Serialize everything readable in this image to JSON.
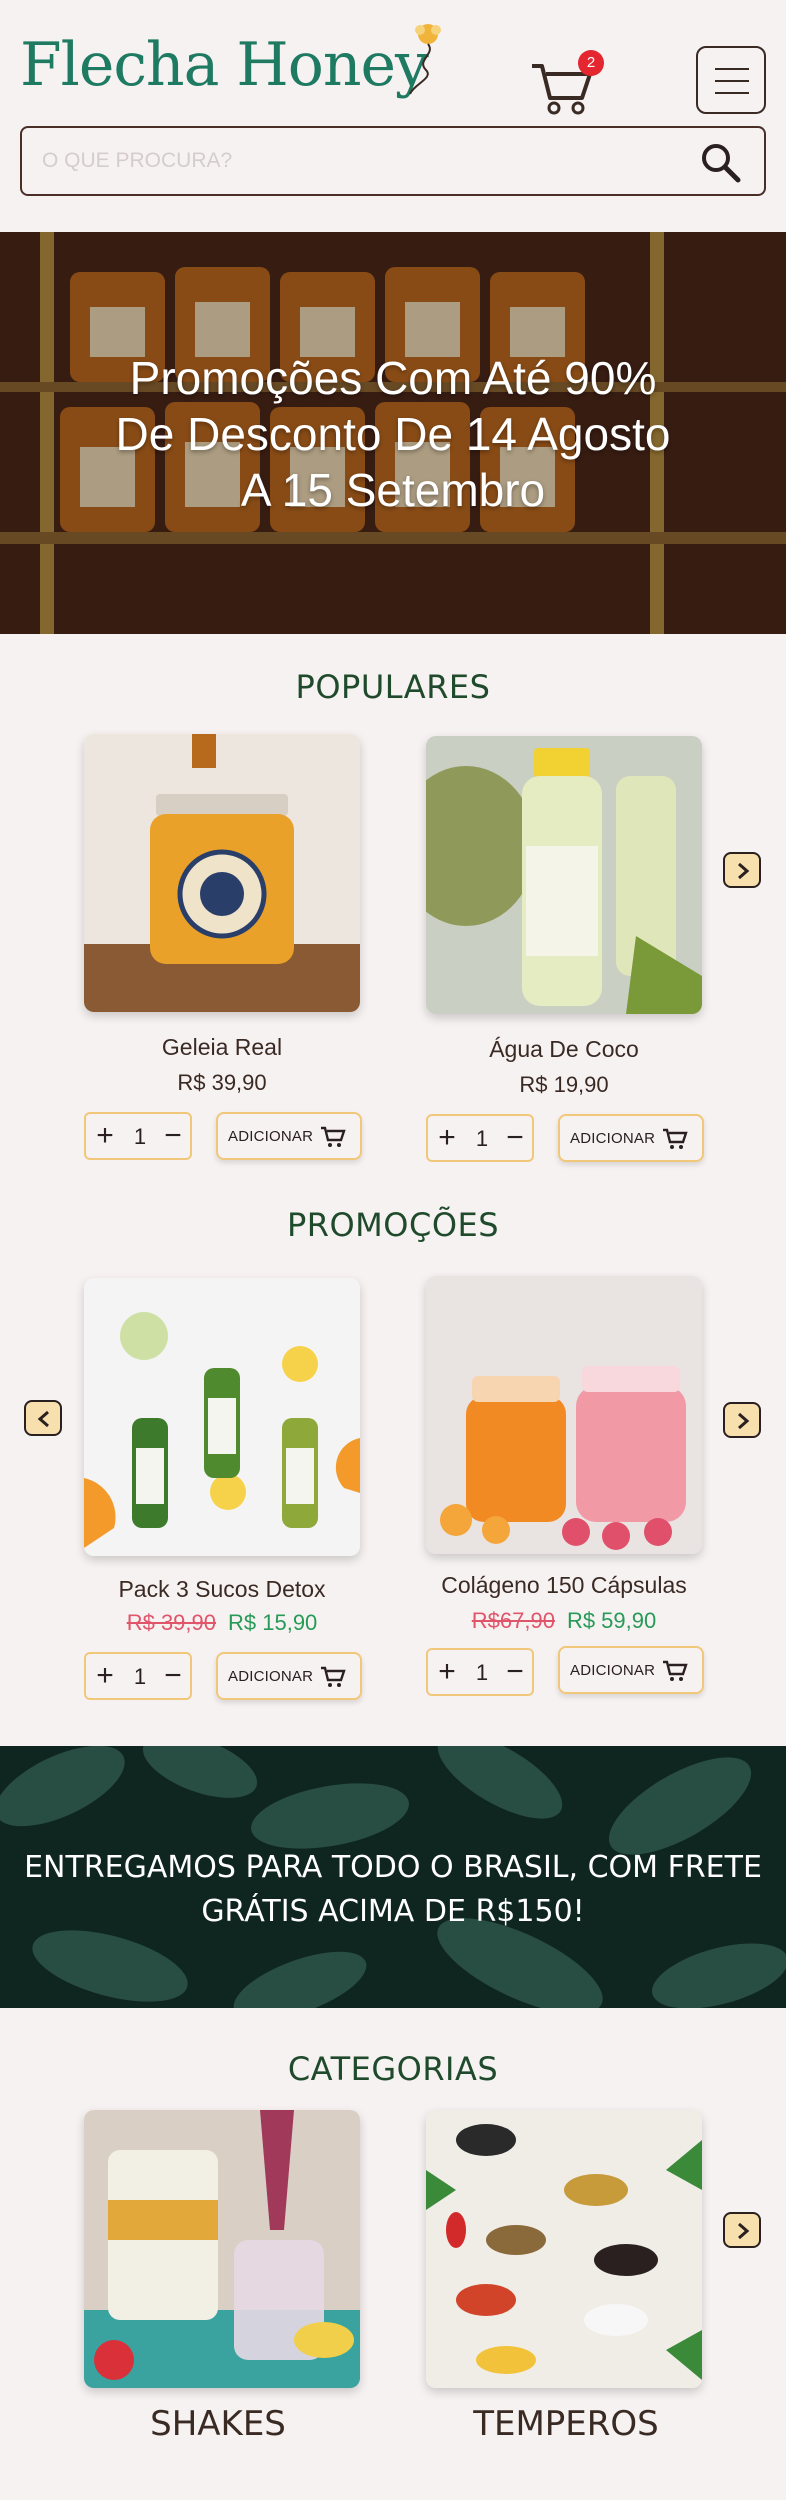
{
  "header": {
    "logo_text": "Flecha Honey",
    "cart_count": "2",
    "search_placeholder": "O QUE PROCURA?"
  },
  "hero": {
    "line1": "Promoções Com Até 90%",
    "line2": "De Desconto De 14 Agosto",
    "line3": "A 15 Setembro"
  },
  "populares": {
    "title": "POPULARES",
    "items": [
      {
        "name": "Geleia Real",
        "price": "R$ 39,90",
        "qty": "1",
        "add_label": "ADICIONAR"
      },
      {
        "name": "Água De Coco",
        "price": "R$ 19,90",
        "qty": "1",
        "add_label": "ADICIONAR"
      }
    ]
  },
  "promocoes": {
    "title": "PROMOÇÕES",
    "items": [
      {
        "name": "Pack 3 Sucos Detox",
        "old_price": "R$ 39,90",
        "new_price": "R$ 15,90",
        "qty": "1",
        "add_label": "ADICIONAR"
      },
      {
        "name": "Colágeno 150 Cápsulas",
        "old_price": "R$67,90",
        "new_price": "R$ 59,90",
        "qty": "1",
        "add_label": "ADICIONAR"
      }
    ]
  },
  "banner": {
    "line1": "ENTREGAMOS PARA TODO O BRASIL, COM FRETE",
    "line2": "GRÁTIS ACIMA DE R$150!"
  },
  "categorias": {
    "title": "CATEGORIAS",
    "items": [
      {
        "label": "SHAKES"
      },
      {
        "label": "TEMPEROS"
      }
    ]
  },
  "colors": {
    "brand_green": "#1f7a62",
    "section_title": "#1f4a2b",
    "button_border": "#f1c77a",
    "arrow_fill": "#f7dfae",
    "old_price": "#e0556a",
    "new_price": "#279a57",
    "badge": "#e3262f"
  }
}
